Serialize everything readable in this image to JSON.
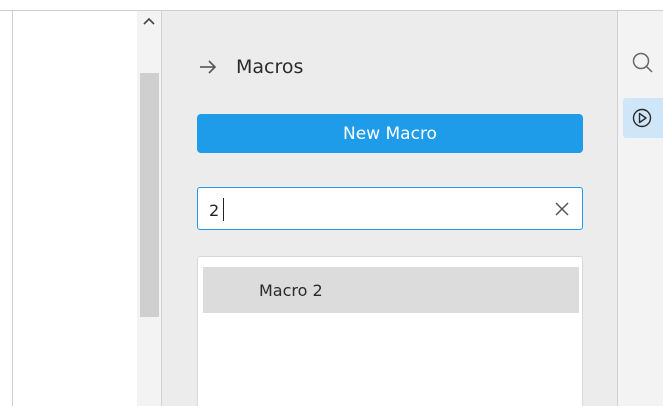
{
  "panel": {
    "title": "Macros",
    "new_macro_label": "New Macro",
    "search": {
      "value": "2",
      "placeholder": ""
    },
    "results": [
      {
        "label": "Macro 2"
      }
    ]
  },
  "icons": {
    "back": "arrow-right-icon",
    "clear": "close-icon",
    "scroll_up": "chevron-up-icon",
    "sidebar_search": "search-icon",
    "sidebar_macros": "play-circle-icon"
  },
  "colors": {
    "accent": "#1e9ce9",
    "selected_row": "#dcdcdc",
    "panel_bg": "#ececed",
    "active_sidebar": "#cfe6f8"
  }
}
